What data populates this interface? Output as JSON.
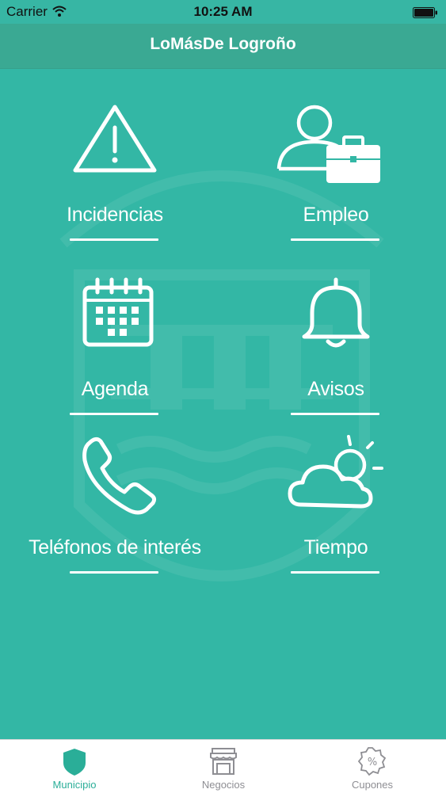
{
  "status_bar": {
    "carrier": "Carrier",
    "time": "10:25 AM"
  },
  "header": {
    "title": "LoMásDe Logroño"
  },
  "tiles": [
    {
      "label": "Incidencias",
      "icon": "warning-icon"
    },
    {
      "label": "Empleo",
      "icon": "employee-briefcase-icon"
    },
    {
      "label": "Agenda",
      "icon": "calendar-icon"
    },
    {
      "label": "Avisos",
      "icon": "bell-icon"
    },
    {
      "label": "Teléfonos de interés",
      "icon": "phone-icon"
    },
    {
      "label": "Tiempo",
      "icon": "weather-icon"
    }
  ],
  "tabbar": {
    "items": [
      {
        "label": "Municipio",
        "icon": "shield-icon",
        "active": true
      },
      {
        "label": "Negocios",
        "icon": "store-icon",
        "active": false
      },
      {
        "label": "Cupones",
        "icon": "percent-badge-icon",
        "active": false
      }
    ]
  },
  "colors": {
    "background": "#33b7a5",
    "header": "#3aa993",
    "active_tab": "#2aae98"
  }
}
